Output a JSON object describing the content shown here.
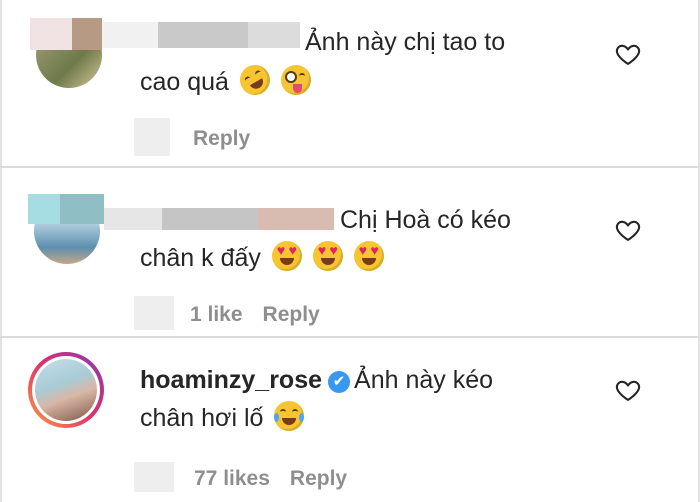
{
  "comments": [
    {
      "text_line1": "Ảnh này chị tao to",
      "text_line2": "cao quá",
      "emojis": [
        "rofl-emoji",
        "zany-face-emoji"
      ],
      "likes": "",
      "reply_label": "Reply"
    },
    {
      "text_line1": "Chị Hoà có kéo",
      "text_line2": "chân k đấy",
      "emojis": [
        "heart-eyes-emoji",
        "heart-eyes-emoji",
        "heart-eyes-emoji"
      ],
      "likes": "1 like",
      "reply_label": "Reply"
    },
    {
      "username": "hoaminzy_rose",
      "verified_mark": "✔",
      "text_line1": "Ảnh này kéo",
      "text_line2": "chân hơi lố",
      "emojis": [
        "tears-of-joy-emoji"
      ],
      "likes": "77 likes",
      "reply_label": "Reply"
    }
  ],
  "colors": {
    "text": "#262626",
    "meta": "#8e8e8e",
    "verified": "#3897f0",
    "divider": "#dbdbdb"
  },
  "icons": [
    "heart-outline-icon",
    "verified-badge-icon"
  ]
}
